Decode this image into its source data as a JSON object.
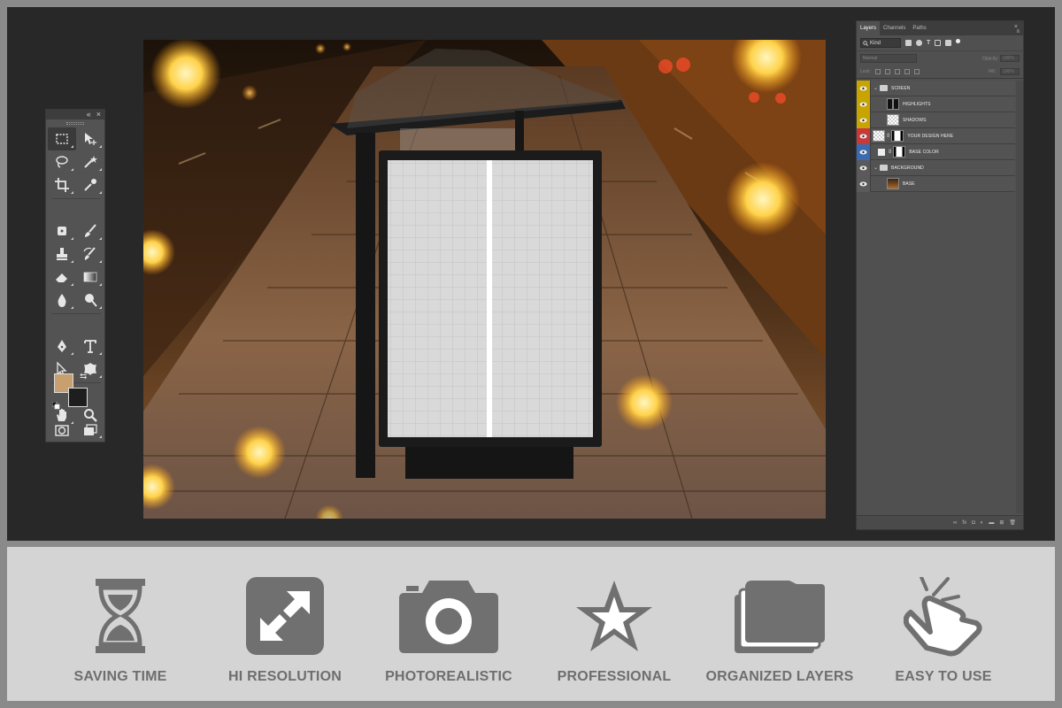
{
  "layers_panel": {
    "tabs": [
      "Layers",
      "Channels",
      "Paths"
    ],
    "close_glyph": "×",
    "menu_glyph": "≡",
    "filter_kind": "Kind",
    "blend_mode": "Normal",
    "opacity_label": "Opacity:",
    "opacity_value": "100%",
    "lock_label": "Lock:",
    "fill_label": "Fill:",
    "fill_value": "100%",
    "layers": [
      {
        "name": "SCREEN",
        "type": "group",
        "eye_color": "#c8a400"
      },
      {
        "name": "HIGHLIGHTS",
        "type": "layer",
        "eye_color": "#c8a400"
      },
      {
        "name": "SHADOWS",
        "type": "layer",
        "eye_color": "#c8a400"
      },
      {
        "name": "YOUR DESIGN HERE",
        "type": "smart-object",
        "eye_color": "#c83a3a"
      },
      {
        "name": "BASE COLOR",
        "type": "fill",
        "eye_color": "#3a6ab0"
      },
      {
        "name": "BACKGROUND",
        "type": "group",
        "eye_color": "#5a5a5a"
      },
      {
        "name": "BASE",
        "type": "image",
        "eye_color": "#5a5a5a"
      }
    ]
  },
  "tools_panel": {
    "collapse_glyph": "«",
    "close_glyph": "×",
    "foreground_color": "#c8a070",
    "background_color": "#1e1e1e"
  },
  "features": [
    {
      "label": "SAVING TIME",
      "icon": "hourglass-icon"
    },
    {
      "label": "HI RESOLUTION",
      "icon": "expand-arrows-icon"
    },
    {
      "label": "PHOTOREALISTIC",
      "icon": "camera-icon"
    },
    {
      "label": "PROFESSIONAL",
      "icon": "star-icon"
    },
    {
      "label": "ORGANIZED LAYERS",
      "icon": "stacked-layers-icon"
    },
    {
      "label": "EASY TO USE",
      "icon": "hand-tap-icon"
    }
  ],
  "colors": {
    "workspace": "#282828",
    "panel": "#535353",
    "feature_strip": "#d4d4d4",
    "feature_text": "#6e6e6e",
    "feature_icon": "#707070"
  }
}
